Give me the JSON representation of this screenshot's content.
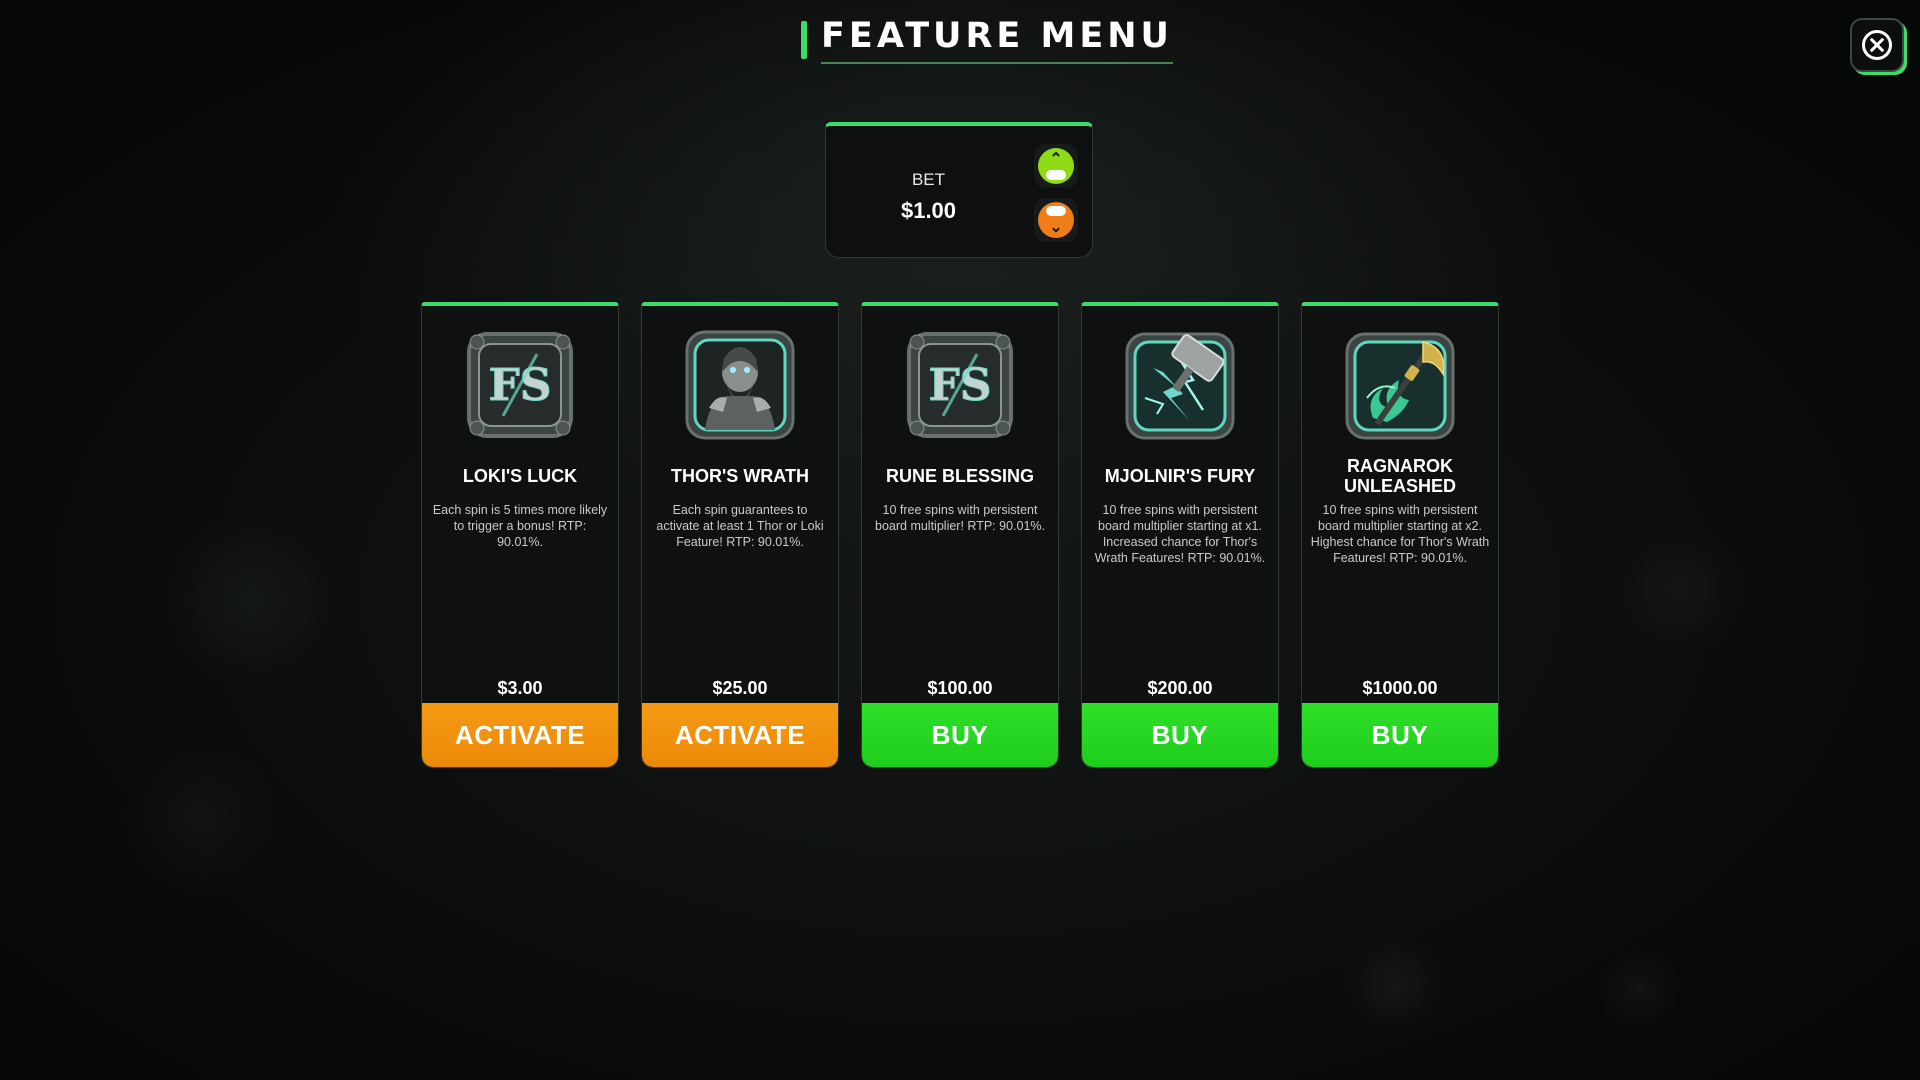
{
  "header": {
    "title": "FEATURE MENU",
    "close_icon": "close-circle-x"
  },
  "bet": {
    "label": "BET",
    "value": "$1.00",
    "increase_icon": "chevron-up-icon",
    "decrease_icon": "chevron-down-icon"
  },
  "colors": {
    "accent": "#3ddc6a",
    "activate": "#f29210",
    "buy": "#26d822"
  },
  "features": [
    {
      "name": "LOKI'S LUCK",
      "description": "Each spin is 5 times more likely to trigger a bonus! RTP: 90.01%.",
      "price": "$3.00",
      "button": "ACTIVATE",
      "icon": "fs-rune-badge"
    },
    {
      "name": "THOR'S WRATH",
      "description": "Each spin guarantees to activate at least 1 Thor or Loki Feature! RTP: 90.01%.",
      "price": "$25.00",
      "button": "ACTIVATE",
      "icon": "thor-portrait"
    },
    {
      "name": "RUNE BLESSING",
      "description": "10 free spins with persistent board multiplier! RTP: 90.01%.",
      "price": "$100.00",
      "button": "BUY",
      "icon": "fs-rune-badge"
    },
    {
      "name": "MJOLNIR'S FURY",
      "description": "10 free spins with persistent board multiplier starting at x1. Increased chance for Thor's Wrath Features! RTP: 90.01%.",
      "price": "$200.00",
      "button": "BUY",
      "icon": "hammer-lightning"
    },
    {
      "name": "RAGNAROK UNLEASHED",
      "description": "10 free spins with persistent board multiplier starting at x2. Highest chance for Thor's Wrath Features! RTP: 90.01%.",
      "price": "$1000.00",
      "button": "BUY",
      "icon": "axe-green-flame"
    }
  ]
}
